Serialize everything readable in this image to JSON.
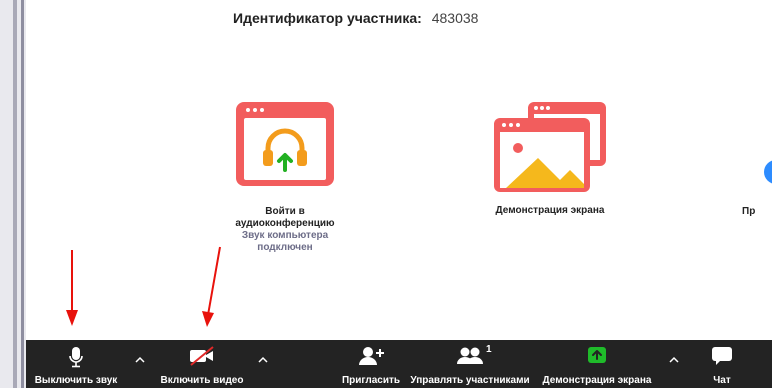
{
  "header": {
    "participant_id_label": "Идентификатор участника:",
    "participant_id_value": "483038"
  },
  "options": [
    {
      "label": "Войти в аудиоконференцию",
      "status": "Звук компьютера подключен",
      "icon": "headphones-upload-icon",
      "color": "#f25d5d"
    },
    {
      "label": "Демонстрация экрана",
      "icon": "screen-share-windows-icon",
      "color": "#f25d5d"
    },
    {
      "label": "Пр",
      "icon": "partial-blue-icon",
      "color": "#2d8cff"
    }
  ],
  "toolbar": {
    "mute_label": "Выключить звук",
    "video_label": "Включить видео",
    "invite_label": "Пригласить",
    "participants_label": "Управлять участниками",
    "participants_count": "1",
    "share_label": "Демонстрация экрана",
    "chat_label": "Чат",
    "share_color": "#1fbb2a",
    "video_off_color": "#e02828"
  },
  "annotations": {
    "arrow_color": "#e8120c"
  }
}
